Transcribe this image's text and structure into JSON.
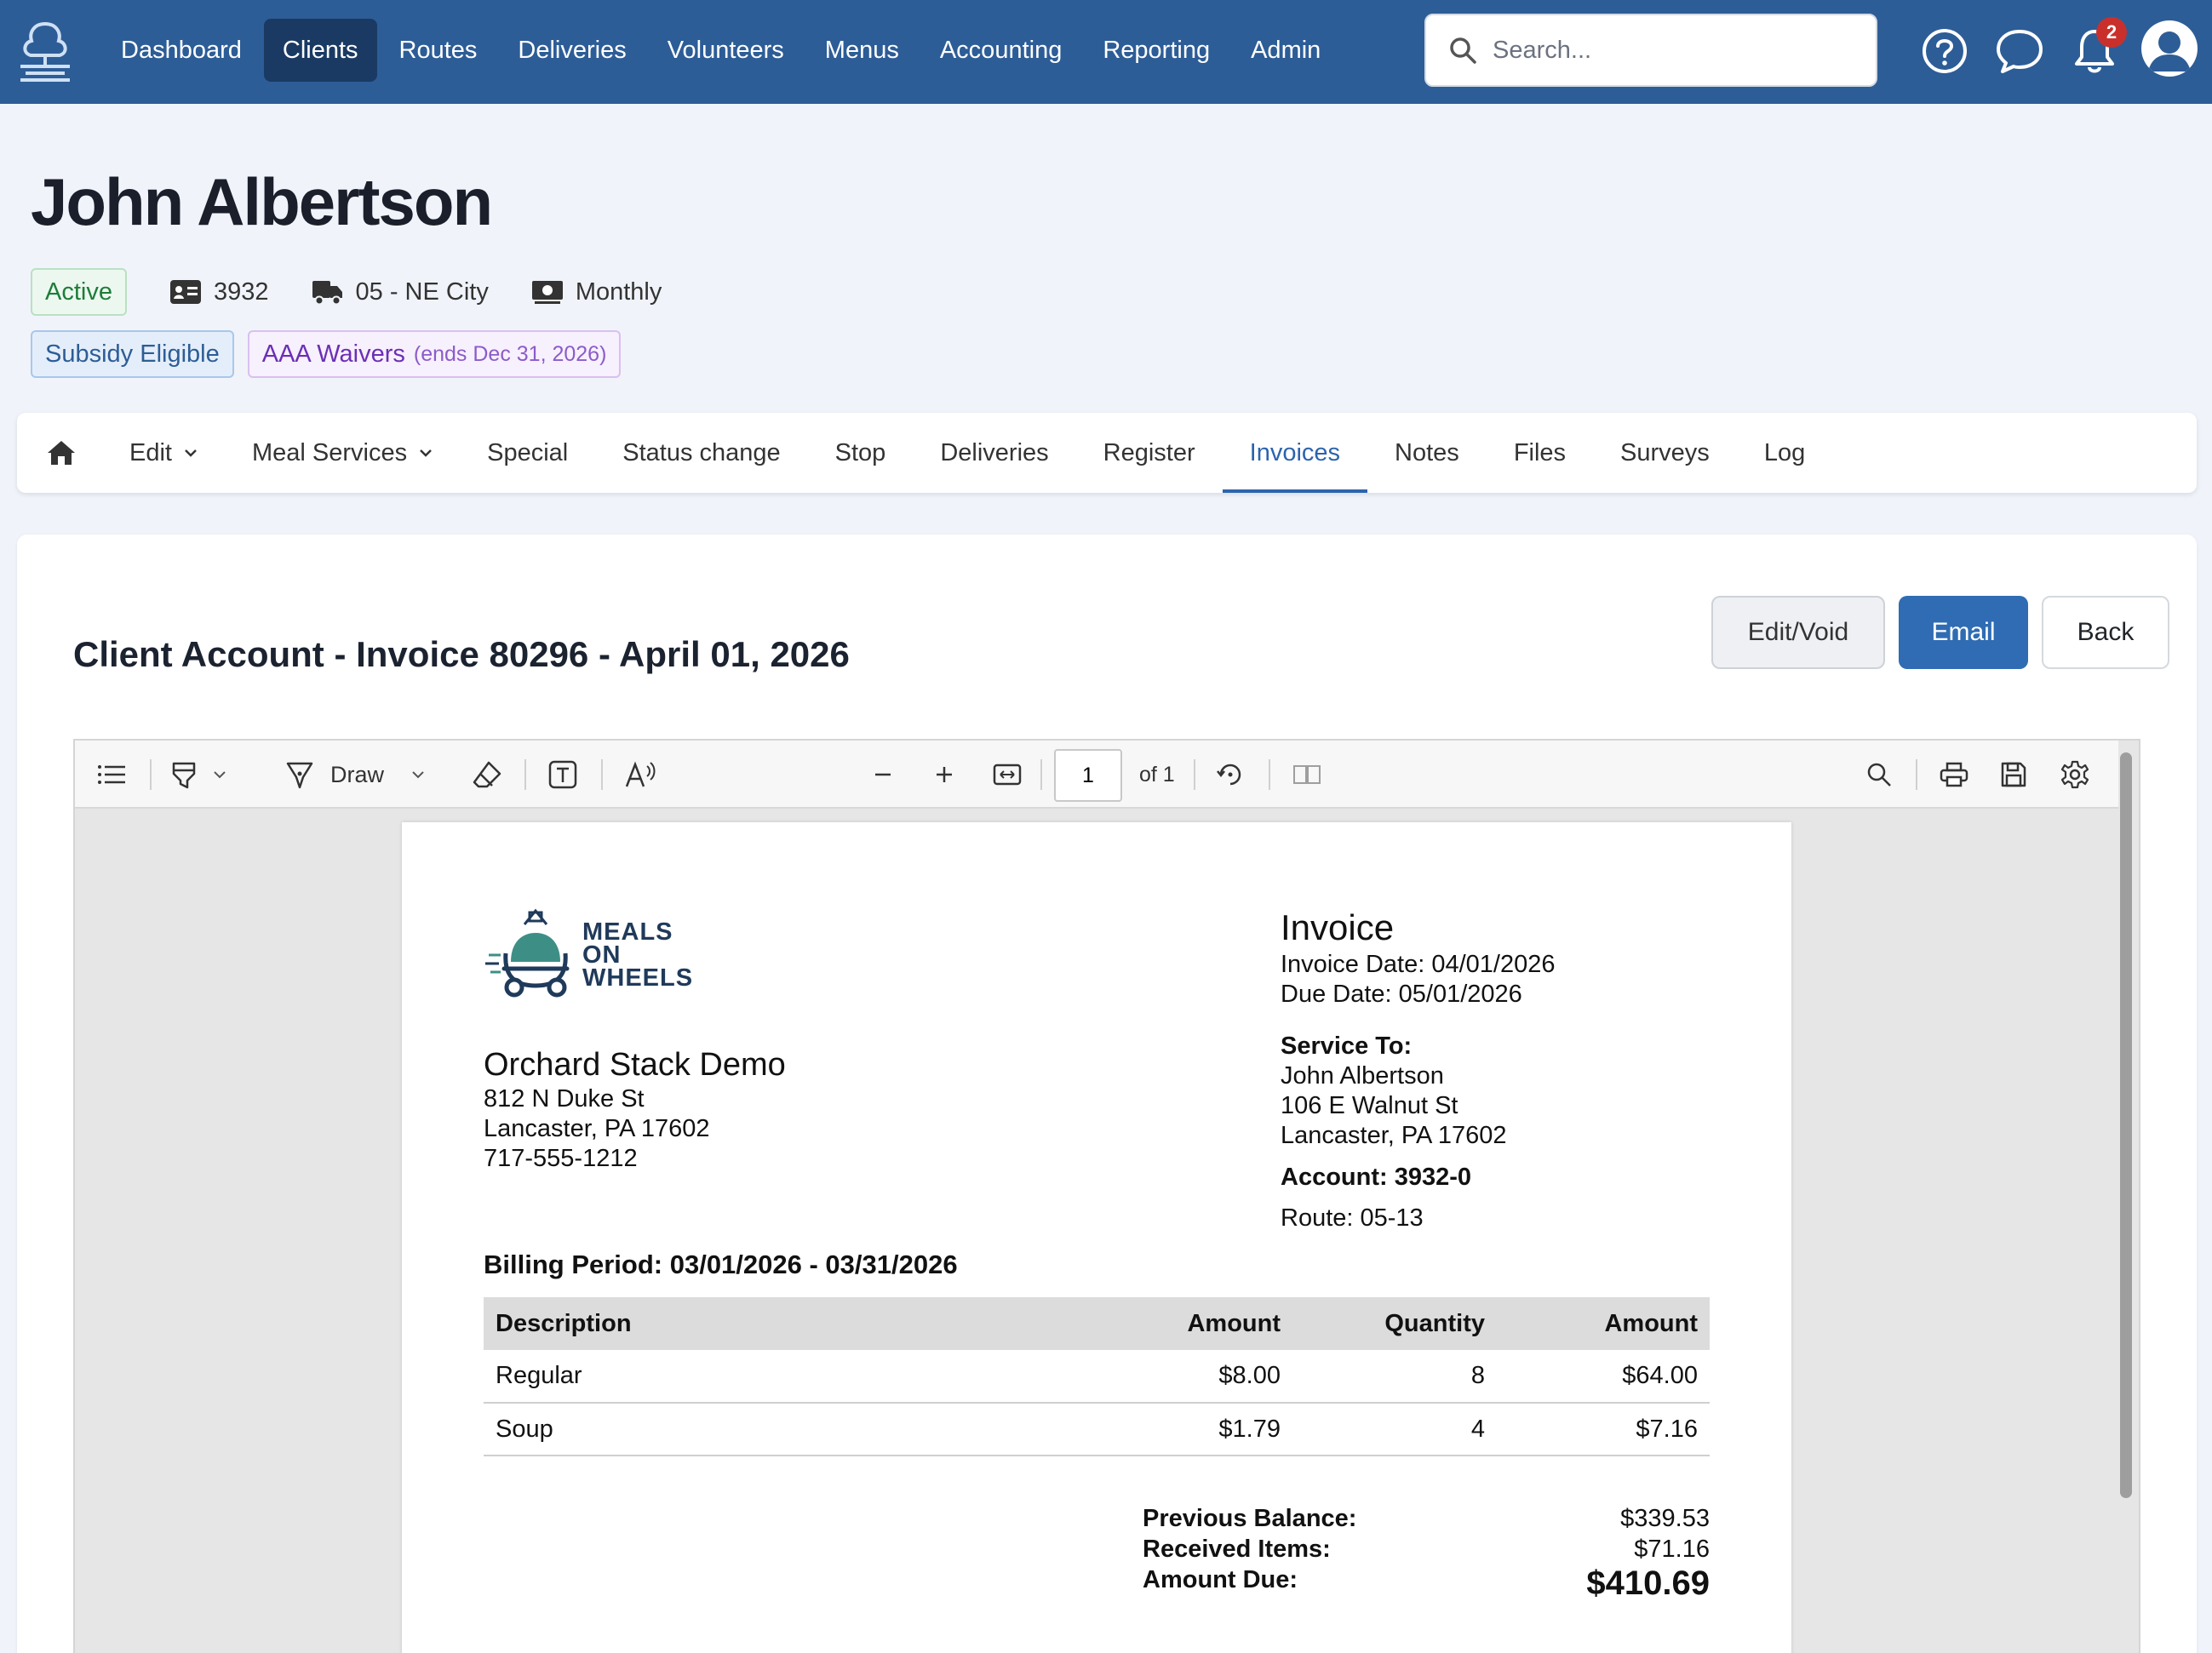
{
  "nav": {
    "items": [
      {
        "label": "Dashboard",
        "name": "nav-dashboard",
        "active": false
      },
      {
        "label": "Clients",
        "name": "nav-clients",
        "active": true
      },
      {
        "label": "Routes",
        "name": "nav-routes",
        "active": false
      },
      {
        "label": "Deliveries",
        "name": "nav-deliveries",
        "active": false
      },
      {
        "label": "Volunteers",
        "name": "nav-volunteers",
        "active": false
      },
      {
        "label": "Menus",
        "name": "nav-menus",
        "active": false
      },
      {
        "label": "Accounting",
        "name": "nav-accounting",
        "active": false
      },
      {
        "label": "Reporting",
        "name": "nav-reporting",
        "active": false
      },
      {
        "label": "Admin",
        "name": "nav-admin",
        "active": false
      }
    ],
    "search_placeholder": "Search...",
    "notification_count": "2"
  },
  "client": {
    "name": "John Albertson",
    "status": "Active",
    "id": "3932",
    "route": "05 - NE City",
    "billing": "Monthly",
    "tag_subsidy": "Subsidy Eligible",
    "tag_waiver": "AAA Waivers",
    "tag_waiver_note": "(ends Dec 31, 2026)"
  },
  "tabs": [
    {
      "label": "Edit",
      "dropdown": true,
      "active": false
    },
    {
      "label": "Meal Services",
      "dropdown": true,
      "active": false
    },
    {
      "label": "Special",
      "dropdown": false,
      "active": false
    },
    {
      "label": "Status change",
      "dropdown": false,
      "active": false
    },
    {
      "label": "Stop",
      "dropdown": false,
      "active": false
    },
    {
      "label": "Deliveries",
      "dropdown": false,
      "active": false
    },
    {
      "label": "Register",
      "dropdown": false,
      "active": false
    },
    {
      "label": "Invoices",
      "dropdown": false,
      "active": true
    },
    {
      "label": "Notes",
      "dropdown": false,
      "active": false
    },
    {
      "label": "Files",
      "dropdown": false,
      "active": false
    },
    {
      "label": "Surveys",
      "dropdown": false,
      "active": false
    },
    {
      "label": "Log",
      "dropdown": false,
      "active": false
    }
  ],
  "invoice_page": {
    "title": "Client Account - Invoice 80296 - April 01, 2026",
    "edit_void_label": "Edit/Void",
    "email_label": "Email",
    "back_label": "Back"
  },
  "viewer": {
    "draw_label": "Draw",
    "page_number": "1",
    "page_count": "of 1"
  },
  "document": {
    "logo_line1": "MEALS",
    "logo_line2": "ON",
    "logo_line3": "WHEELS",
    "org_name": "Orchard Stack Demo",
    "org_address1": "812 N Duke St",
    "org_address2": "Lancaster, PA 17602",
    "org_phone": "717-555-1212",
    "heading": "Invoice",
    "invoice_date": "Invoice Date: 04/01/2026",
    "due_date": "Due Date: 05/01/2026",
    "service_to_label": "Service To:",
    "service_name": "John Albertson",
    "service_address1": "106 E Walnut St",
    "service_address2": "Lancaster, PA 17602",
    "account": "Account: 3932-0",
    "route": "Route: 05-13",
    "billing_period": "Billing Period: 03/01/2026 - 03/31/2026",
    "table": {
      "headers": [
        "Description",
        "Amount",
        "Quantity",
        "Amount"
      ],
      "rows": [
        {
          "description": "Regular",
          "unit": "$8.00",
          "quantity": "8",
          "amount": "$64.00"
        },
        {
          "description": "Soup",
          "unit": "$1.79",
          "quantity": "4",
          "amount": "$7.16"
        }
      ]
    },
    "previous_balance_label": "Previous Balance:",
    "previous_balance": "$339.53",
    "received_items_label": "Received Items:",
    "received_items": "$71.16",
    "amount_due_label": "Amount Due:",
    "amount_due": "$410.69"
  },
  "colors": {
    "topbar": "#2d5d97",
    "nav_active": "#1a3a64",
    "accent": "#2c64ad",
    "email_button": "#2f6cb3",
    "badge": "#c9302c",
    "logo_teal": "#3d8f86",
    "logo_navy": "#1f3a5a"
  }
}
